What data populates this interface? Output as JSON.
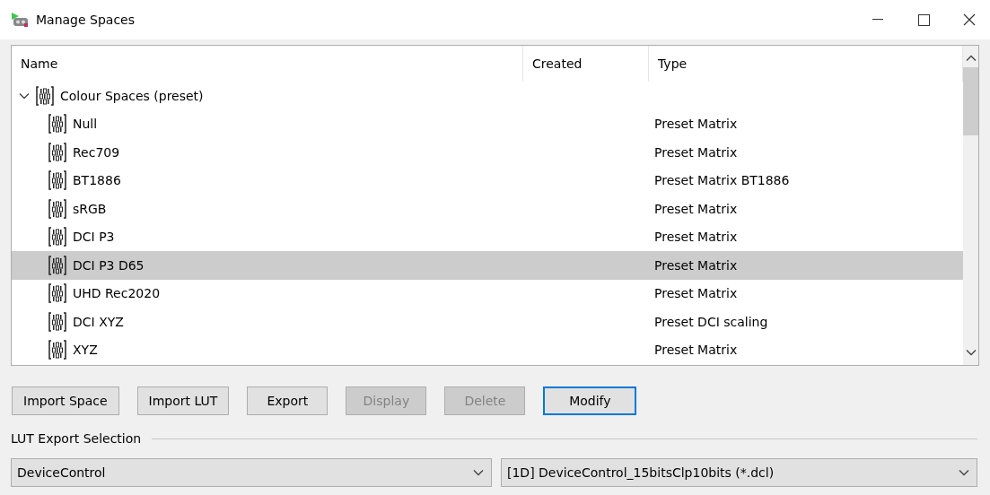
{
  "window": {
    "title": "Manage Spaces"
  },
  "tree": {
    "columns": [
      "Name",
      "Created",
      "Type"
    ],
    "items": [
      {
        "name": "Colour Spaces (preset)",
        "expanded": true,
        "selected": false,
        "children": [
          {
            "name": "Null",
            "type": "Preset Matrix",
            "selected": false
          },
          {
            "name": "Rec709",
            "type": "Preset Matrix",
            "selected": false
          },
          {
            "name": "BT1886",
            "type": "Preset Matrix BT1886",
            "selected": false
          },
          {
            "name": "sRGB",
            "type": "Preset Matrix",
            "selected": false
          },
          {
            "name": "DCI P3",
            "type": "Preset Matrix",
            "selected": false
          },
          {
            "name": "DCI P3 D65",
            "type": "Preset Matrix",
            "selected": true
          },
          {
            "name": "UHD Rec2020",
            "type": "Preset Matrix",
            "selected": false
          },
          {
            "name": "DCI XYZ",
            "type": "Preset DCI scaling",
            "selected": false
          },
          {
            "name": "XYZ",
            "type": "Preset Matrix",
            "selected": false
          }
        ]
      }
    ]
  },
  "buttons": [
    {
      "label": "Import Space",
      "disabled": false,
      "focused": false
    },
    {
      "label": "Import LUT",
      "disabled": false,
      "focused": false
    },
    {
      "label": "Export",
      "disabled": false,
      "focused": false
    },
    {
      "label": "Display",
      "disabled": true,
      "focused": false
    },
    {
      "label": "Delete",
      "disabled": true,
      "focused": false
    },
    {
      "label": "Modify",
      "disabled": false,
      "focused": true
    }
  ],
  "lut_export": {
    "title": "LUT Export Selection",
    "format": "DeviceControl",
    "file_type": "[1D] DeviceControl_15bitsClp10bits (*.dcl)"
  }
}
